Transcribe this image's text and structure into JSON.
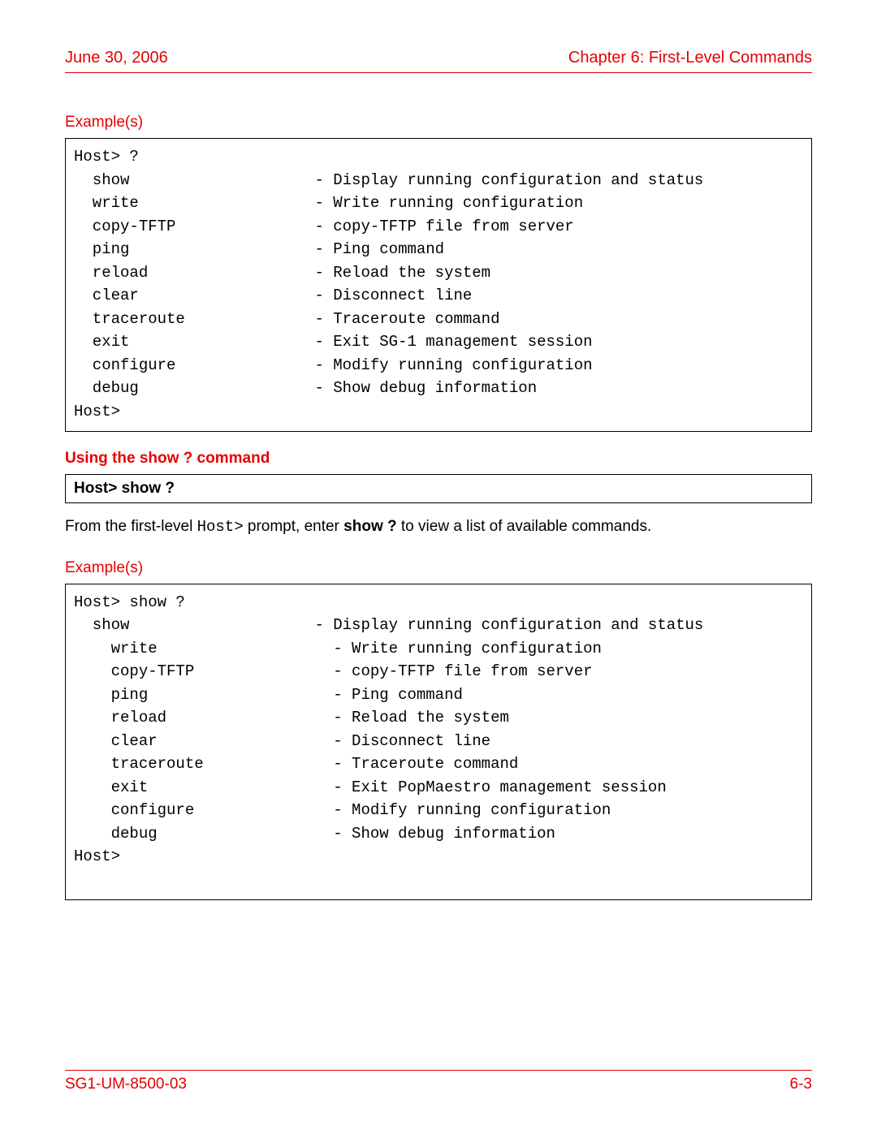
{
  "header": {
    "left": "June 30, 2006",
    "right": "Chapter 6: First-Level Commands"
  },
  "section1": {
    "label": "Example(s)",
    "code": "Host> ?\n  show                    - Display running configuration and status\n  write                   - Write running configuration\n  copy-TFTP               - copy-TFTP file from server\n  ping                    - Ping command\n  reload                  - Reload the system\n  clear                   - Disconnect line\n  traceroute              - Traceroute command\n  exit                    - Exit SG-1 management session\n  configure               - Modify running configuration\n  debug                   - Show debug information\nHost>"
  },
  "subheading": "Using the show ? command",
  "promptBox": "Host> show ?",
  "bodyText": {
    "pre": "From the first-level ",
    "mono": "Host>",
    "mid": " prompt, enter ",
    "bold": "show ?",
    "post": " to view a list of available commands."
  },
  "section2": {
    "label": "Example(s)",
    "code": "Host> show ?\n  show                    - Display running configuration and status\n    write                   - Write running configuration\n    copy-TFTP               - copy-TFTP file from server\n    ping                    - Ping command\n    reload                  - Reload the system\n    clear                   - Disconnect line\n    traceroute              - Traceroute command\n    exit                    - Exit PopMaestro management session\n    configure               - Modify running configuration\n    debug                   - Show debug information\nHost>\n "
  },
  "footer": {
    "left": "SG1-UM-8500-03",
    "right": "6-3"
  }
}
